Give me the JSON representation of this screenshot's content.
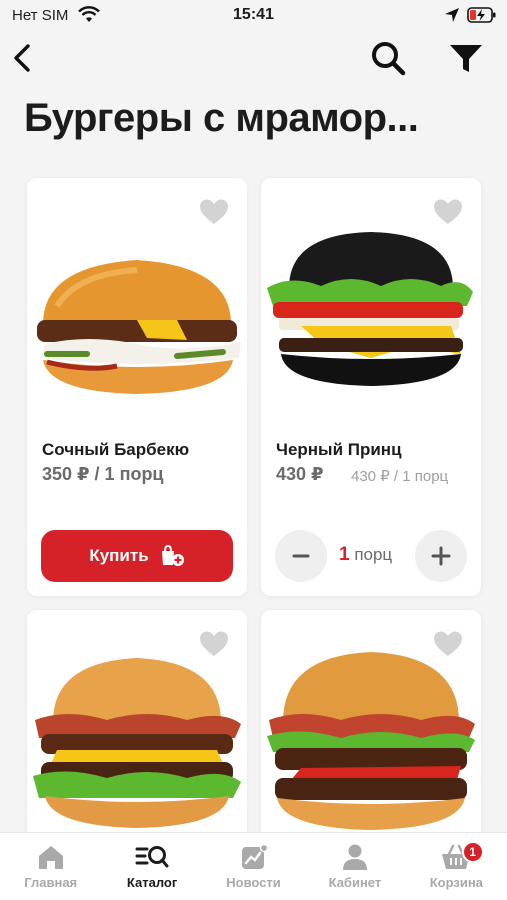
{
  "status_bar": {
    "carrier": "Нет SIM",
    "time": "15:41"
  },
  "page": {
    "title": "Бургеры с мрамор..."
  },
  "products": [
    {
      "name": "Сочный Барбекю",
      "price": "350 ₽ / 1 порц",
      "buy_label": "Купить"
    },
    {
      "name": "Черный Принц",
      "price": "430 ₽",
      "old_price": "430 ₽ / 1 порц",
      "qty_number": "1",
      "qty_unit": "порц"
    }
  ],
  "tabs": [
    {
      "label": "Главная",
      "icon": "home-icon"
    },
    {
      "label": "Каталог",
      "icon": "catalog-search-icon"
    },
    {
      "label": "Новости",
      "icon": "news-icon"
    },
    {
      "label": "Кабинет",
      "icon": "user-icon"
    },
    {
      "label": "Корзина",
      "icon": "basket-icon",
      "badge": "1"
    }
  ],
  "colors": {
    "accent": "#d62128",
    "inactive": "#a9a9a9",
    "background": "#f4f4f4"
  }
}
